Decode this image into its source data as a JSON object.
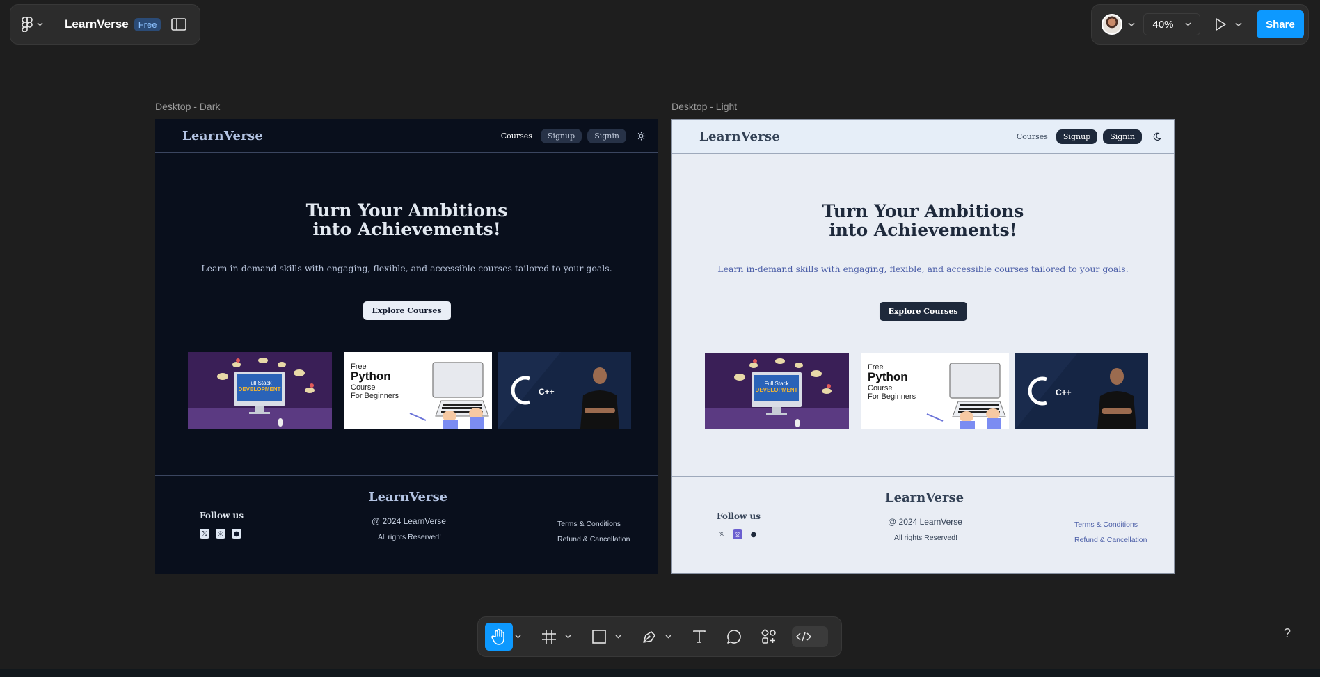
{
  "app": {
    "title": "LearnVerse",
    "plan_badge": "Free"
  },
  "toolbar_right": {
    "zoom": "40%",
    "share_label": "Share"
  },
  "frames": [
    {
      "label": "Desktop - Dark",
      "theme": "dark"
    },
    {
      "label": "Desktop - Light",
      "theme": "light"
    }
  ],
  "site": {
    "brand": "LearnVerse",
    "nav": {
      "courses": "Courses",
      "signup": "Signup",
      "signin": "Signin"
    },
    "hero": {
      "title_line1": "Turn Your Ambitions",
      "title_line2": "into Achievements!",
      "subtitle": "Learn in-demand skills with engaging, flexible, and accessible courses tailored to your goals.",
      "cta": "Explore Courses"
    },
    "courses": [
      {
        "line1": "Full Stack",
        "line2": "DEVELOPMENT"
      },
      {
        "line1": "Free",
        "line2": "Python",
        "line3": "Course",
        "line4": "For Beginners"
      },
      {
        "line1": "C++"
      }
    ],
    "footer": {
      "brand": "LearnVerse",
      "follow": "Follow us",
      "copyright": "@ 2024 LearnVerse",
      "rights": "All rights Reserved!",
      "terms": "Terms & Conditions",
      "refund": "Refund & Cancellation"
    }
  },
  "icons": {
    "theme_dark_frame": "sun-icon",
    "theme_light_frame": "moon-icon",
    "socials": [
      "x-icon",
      "instagram-icon",
      "github-icon"
    ]
  },
  "colors": {
    "accent": "#0d99ff",
    "canvas": "#1e1e1e",
    "dark_site_bg": "#090f1c",
    "light_site_bg": "#e9edf4"
  },
  "help_label": "?"
}
